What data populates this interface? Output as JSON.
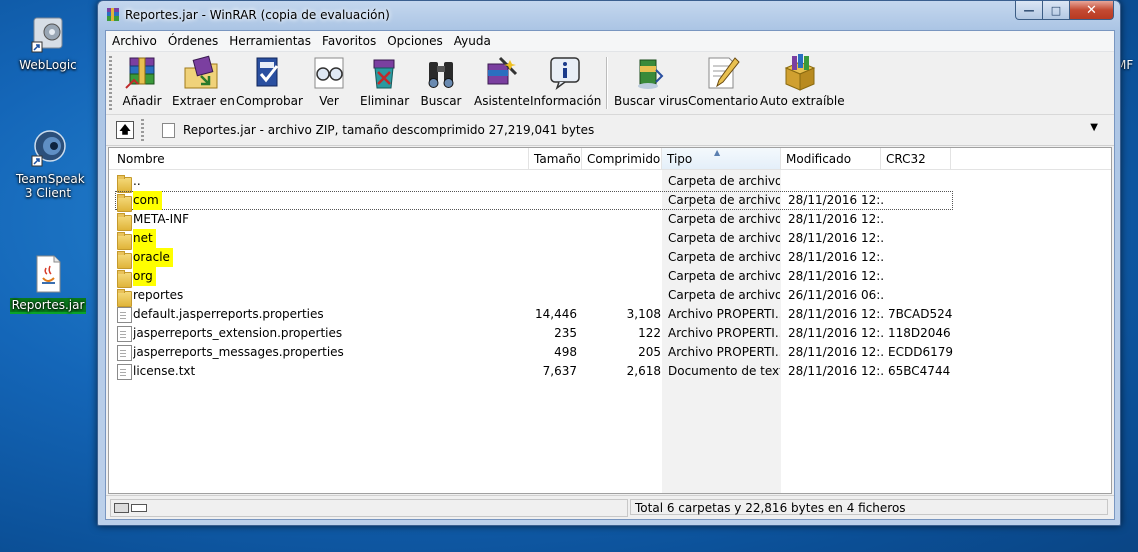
{
  "desktop": {
    "icons": [
      {
        "label": "WebLogic"
      },
      {
        "label": "TeamSpeak 3 Client"
      },
      {
        "label": "Reportes.jar"
      }
    ],
    "edge_text": "MF"
  },
  "window": {
    "title": "Reportes.jar - WinRAR (copia de evaluación)",
    "controls": {
      "minimize": "—",
      "maximize": "□",
      "close": "✕"
    }
  },
  "menu": [
    "Archivo",
    "Órdenes",
    "Herramientas",
    "Favoritos",
    "Opciones",
    "Ayuda"
  ],
  "toolbar": [
    {
      "label": "Añadir",
      "icon": "add-archive-icon"
    },
    {
      "label": "Extraer en",
      "icon": "extract-icon"
    },
    {
      "label": "Comprobar",
      "icon": "test-icon"
    },
    {
      "label": "Ver",
      "icon": "view-glasses-icon"
    },
    {
      "label": "Eliminar",
      "icon": "delete-icon"
    },
    {
      "label": "Buscar",
      "icon": "binoculars-icon"
    },
    {
      "label": "Asistente",
      "icon": "wizard-icon"
    },
    {
      "label": "Información",
      "icon": "info-icon"
    },
    {
      "label": "Buscar virus",
      "icon": "virus-scan-icon"
    },
    {
      "label": "Comentario",
      "icon": "comment-icon"
    },
    {
      "label": "Auto extraíble",
      "icon": "sfx-icon"
    }
  ],
  "address": {
    "text": "Reportes.jar - archivo ZIP, tamaño descomprimido 27,219,041 bytes"
  },
  "columns": {
    "name": "Nombre",
    "size": "Tamaño",
    "packed": "Comprimido",
    "type": "Tipo",
    "modified": "Modificado",
    "crc": "CRC32",
    "sorted": "type"
  },
  "files": [
    {
      "name": "..",
      "size": "",
      "packed": "",
      "type": "Carpeta de archivos",
      "modified": "",
      "crc": "",
      "kind": "folder",
      "highlight": false,
      "focused": false
    },
    {
      "name": "com",
      "size": "",
      "packed": "",
      "type": "Carpeta de archivos",
      "modified": "28/11/2016 12:...",
      "crc": "",
      "kind": "folder",
      "highlight": true,
      "focused": true
    },
    {
      "name": "META-INF",
      "size": "",
      "packed": "",
      "type": "Carpeta de archivos",
      "modified": "28/11/2016 12:...",
      "crc": "",
      "kind": "folder",
      "highlight": false,
      "focused": false
    },
    {
      "name": "net",
      "size": "",
      "packed": "",
      "type": "Carpeta de archivos",
      "modified": "28/11/2016 12:...",
      "crc": "",
      "kind": "folder",
      "highlight": true,
      "focused": false
    },
    {
      "name": "oracle",
      "size": "",
      "packed": "",
      "type": "Carpeta de archivos",
      "modified": "28/11/2016 12:...",
      "crc": "",
      "kind": "folder",
      "highlight": true,
      "focused": false
    },
    {
      "name": "org",
      "size": "",
      "packed": "",
      "type": "Carpeta de archivos",
      "modified": "28/11/2016 12:...",
      "crc": "",
      "kind": "folder",
      "highlight": true,
      "focused": false
    },
    {
      "name": "reportes",
      "size": "",
      "packed": "",
      "type": "Carpeta de archivos",
      "modified": "26/11/2016 06:...",
      "crc": "",
      "kind": "folder",
      "highlight": false,
      "focused": false
    },
    {
      "name": "default.jasperreports.properties",
      "size": "14,446",
      "packed": "3,108",
      "type": "Archivo PROPERTI...",
      "modified": "28/11/2016 12:...",
      "crc": "7BCAD524",
      "kind": "file",
      "highlight": false,
      "focused": false
    },
    {
      "name": "jasperreports_extension.properties",
      "size": "235",
      "packed": "122",
      "type": "Archivo PROPERTI...",
      "modified": "28/11/2016 12:...",
      "crc": "118D2046",
      "kind": "file",
      "highlight": false,
      "focused": false
    },
    {
      "name": "jasperreports_messages.properties",
      "size": "498",
      "packed": "205",
      "type": "Archivo PROPERTI...",
      "modified": "28/11/2016 12:...",
      "crc": "ECDD6179",
      "kind": "file",
      "highlight": false,
      "focused": false
    },
    {
      "name": "license.txt",
      "size": "7,637",
      "packed": "2,618",
      "type": "Documento de texto",
      "modified": "28/11/2016 12:...",
      "crc": "65BC4744",
      "kind": "file",
      "highlight": false,
      "focused": false
    }
  ],
  "status": {
    "summary": "Total 6 carpetas y 22,816 bytes en 4 ficheros"
  }
}
